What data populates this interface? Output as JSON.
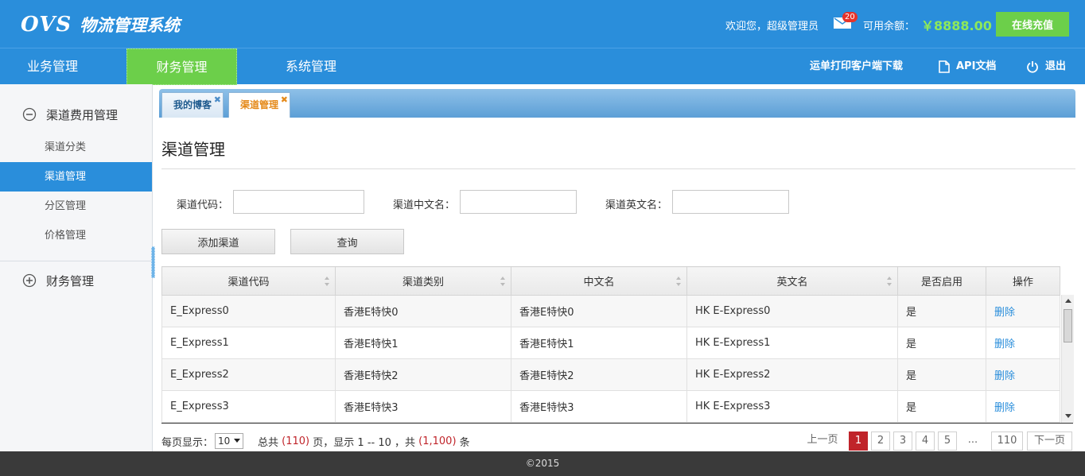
{
  "header": {
    "logo_mark": "OVS",
    "logo_title": "物流管理系统",
    "welcome": "欢迎您，超级管理员",
    "mail_count": "20",
    "balance_label": "可用余额：",
    "balance_value": "￥8888.00",
    "recharge_label": "在线充值"
  },
  "nav": {
    "items": [
      "业务管理",
      "财务管理",
      "系统管理"
    ],
    "active_index": 1,
    "right": {
      "print_client": "运单打印客户端下载",
      "api_docs": "API文档",
      "logout": "退出"
    }
  },
  "sidebar": {
    "group1": "渠道费用管理",
    "items": [
      "渠道分类",
      "渠道管理",
      "分区管理",
      "价格管理"
    ],
    "active_index": 1,
    "group2": "财务管理"
  },
  "tabs": [
    "我的博客",
    "渠道管理"
  ],
  "tab_close_glyph": "✖",
  "page": {
    "title": "渠道管理",
    "filters": {
      "code_label": "渠道代码：",
      "code_value": "",
      "cn_label": "渠道中文名：",
      "cn_value": "",
      "en_label": "渠道英文名：",
      "en_value": ""
    },
    "add_button": "添加渠道",
    "query_button": "查询"
  },
  "table": {
    "headers": [
      "渠道代码",
      "渠道类别",
      "中文名",
      "英文名",
      "是否启用",
      "操作"
    ],
    "rows": [
      [
        "E_Express0",
        "香港E特快0",
        "香港E特快0",
        "HK E-Express0",
        "是",
        "删除"
      ],
      [
        "E_Express1",
        "香港E特快1",
        "香港E特快1",
        "HK E-Express1",
        "是",
        "删除"
      ],
      [
        "E_Express2",
        "香港E特快2",
        "香港E特快2",
        "HK E-Express2",
        "是",
        "删除"
      ],
      [
        "E_Express3",
        "香港E特快3",
        "香港E特快3",
        "HK E-Express3",
        "是",
        "删除"
      ]
    ]
  },
  "pager": {
    "per_page_label": "每页显示：",
    "per_page_value": "10",
    "summary_prefix": "总共",
    "total_pages": "(110)",
    "summary_mid": "页，显示 1 -- 10 ，共",
    "total_items": "(1,100)",
    "summary_suffix": "条",
    "prev": "上一页",
    "pages": [
      "1",
      "2",
      "3",
      "4",
      "5"
    ],
    "current_page": "1",
    "ellipsis": "...",
    "last": "110",
    "next": "下一页"
  },
  "footer": {
    "copyright": "©2015"
  },
  "colors": {
    "brand_blue": "#2a8edb",
    "accent_green": "#6ccf4a",
    "balance_green": "#8ee95a",
    "pager_red": "#c0242a",
    "tab_orange": "#e58a1a"
  },
  "icons": {
    "mail": "mail-icon",
    "document": "document-icon",
    "power": "power-icon",
    "collapse": "minus-circle-icon",
    "expand": "plus-circle-icon",
    "sort": "sort-icon",
    "dropdown": "chevron-down-icon"
  }
}
